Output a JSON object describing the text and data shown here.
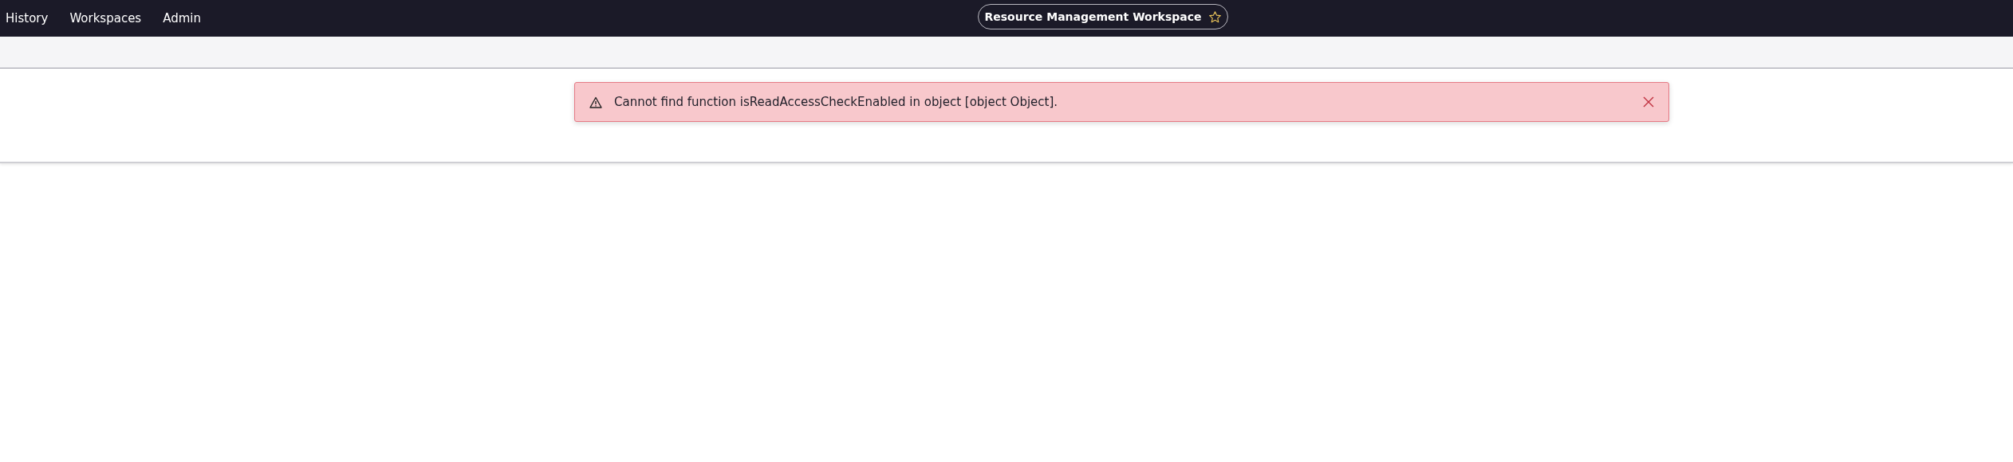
{
  "nav": {
    "items": [
      {
        "label": "History"
      },
      {
        "label": "Workspaces"
      },
      {
        "label": "Admin"
      }
    ],
    "workspace": {
      "title": "Resource Management Workspace",
      "favorite": false
    }
  },
  "alert": {
    "message": "Cannot find function isReadAccessCheckEnabled in object [object Object]."
  }
}
